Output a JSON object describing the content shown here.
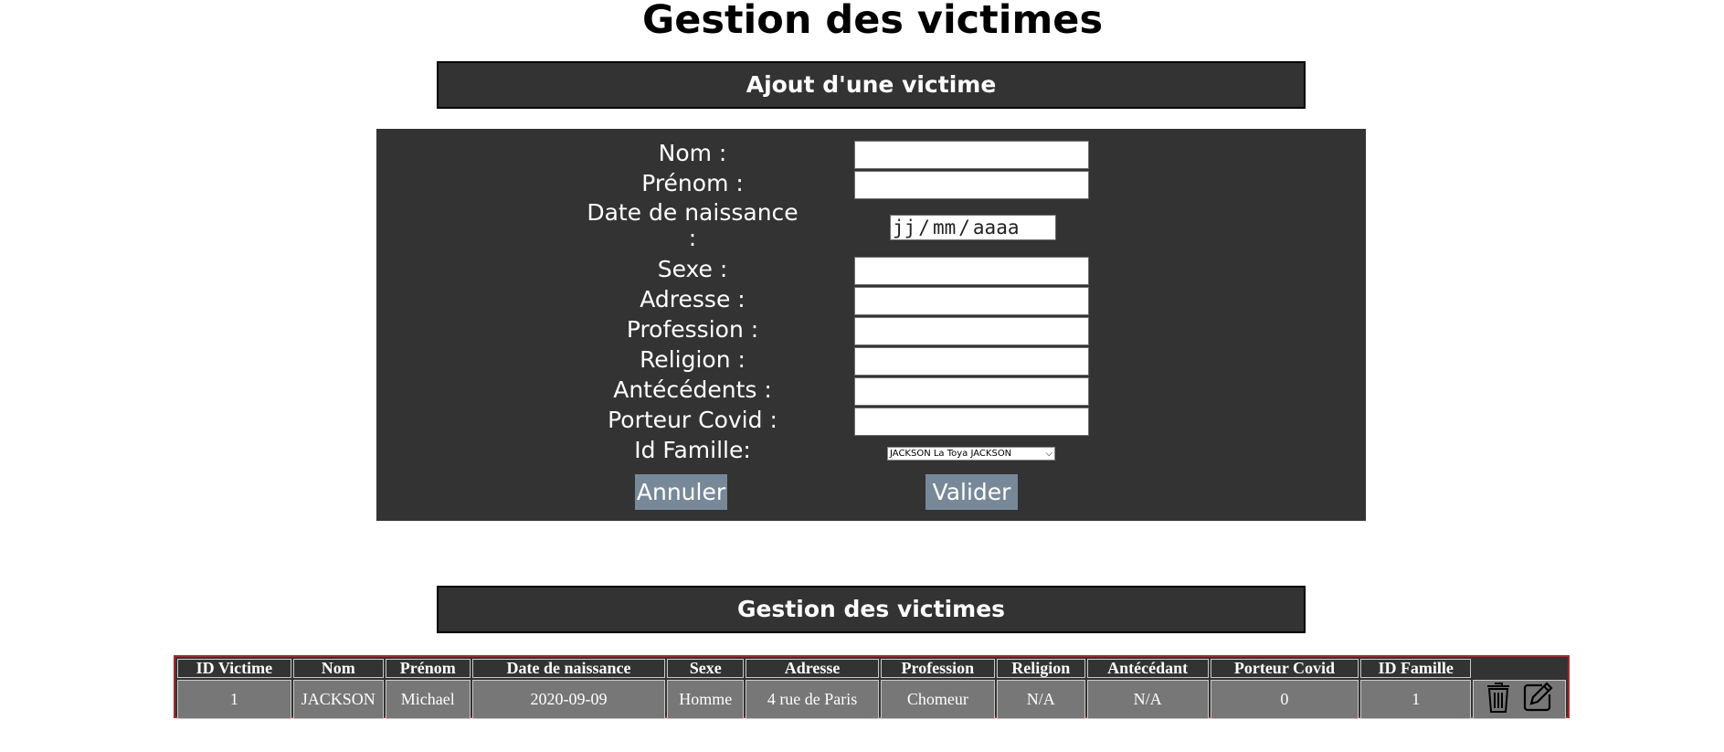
{
  "page": {
    "title": "Gestion des victimes"
  },
  "add_section": {
    "title": "Ajout d'une victime"
  },
  "form": {
    "labels": {
      "nom": "Nom :",
      "prenom": "Prénom :",
      "date_naissance_line1": "Date de naissance",
      "date_naissance_line2": ":",
      "sexe": "Sexe :",
      "adresse": "Adresse :",
      "profession": "Profession :",
      "religion": "Religion :",
      "antecedents": "Antécédents :",
      "porteur_covid": "Porteur Covid :",
      "id_famille": "Id Famille:"
    },
    "values": {
      "nom": "",
      "prenom": "",
      "sexe": "",
      "adresse": "",
      "profession": "",
      "religion": "",
      "antecedents": "",
      "porteur_covid": ""
    },
    "date_placeholder": {
      "day": "jj",
      "month": "mm",
      "year": "aaaa",
      "separator": "/"
    },
    "famille_select": {
      "selected": "JACKSON La Toya JACKSON"
    },
    "buttons": {
      "cancel": "Annuler",
      "submit": "Valider"
    }
  },
  "manage_section": {
    "title": "Gestion des victimes"
  },
  "table": {
    "headers": [
      "ID Victime",
      "Nom",
      "Prénom",
      "Date de naissance",
      "Sexe",
      "Adresse",
      "Profession",
      "Religion",
      "Antécédant",
      "Porteur Covid",
      "ID Famille"
    ],
    "rows": [
      [
        "1",
        "JACKSON",
        "Michael",
        "2020-09-09",
        "Homme",
        "4 rue de Paris",
        "Chomeur",
        "N/A",
        "N/A",
        "0",
        "1"
      ]
    ],
    "row_actions": [
      "trash-icon",
      "edit-icon"
    ]
  },
  "colors": {
    "panel": "#333333",
    "button": "#778899",
    "table_border": "#a52a2a",
    "cell": "#777777"
  }
}
